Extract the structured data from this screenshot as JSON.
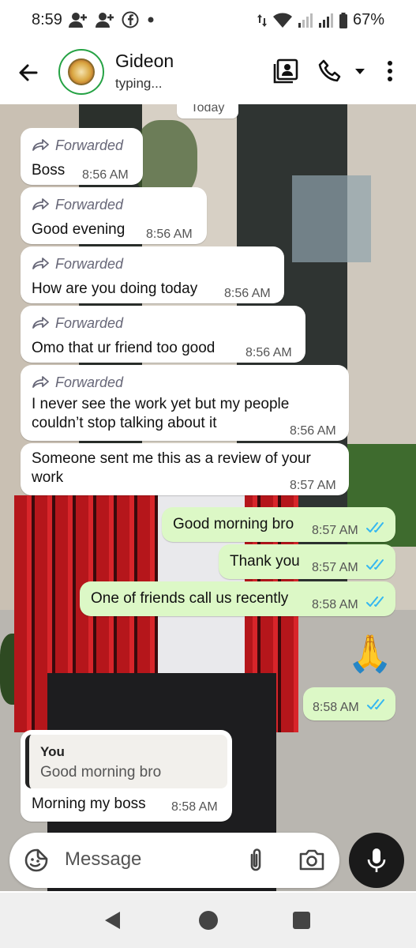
{
  "status_bar": {
    "time": "8:59",
    "battery": "67%",
    "icons": [
      "person-add-icon",
      "person-add-icon",
      "facebook-icon",
      "dot-icon",
      "data-arrows-icon",
      "wifi-icon",
      "signal-icon",
      "signal-icon",
      "battery-icon"
    ]
  },
  "header": {
    "contact_name": "Gideon",
    "status": "typing...",
    "icons": [
      "back-arrow-icon",
      "contact-card-icon",
      "phone-icon",
      "chevron-down-icon",
      "more-vert-icon"
    ]
  },
  "chat": {
    "date_chip": "Today",
    "forwarded_label": "Forwarded",
    "messages": [
      {
        "text": "Boss",
        "time": "8:56 AM"
      },
      {
        "text": "Good evening",
        "time": "8:56 AM"
      },
      {
        "text": "How are you doing today",
        "time": "8:56 AM"
      },
      {
        "text": "Omo that ur friend too good",
        "time": "8:56 AM"
      },
      {
        "line1": "I never see the work yet but my people",
        "line2": "couldn’t stop talking about it",
        "time": "8:56 AM"
      },
      {
        "line1": "Someone sent me this as a review of your",
        "line2": "work",
        "time": "8:57 AM"
      }
    ],
    "outgoing": [
      {
        "text": "Good morning bro",
        "time": "8:57 AM"
      },
      {
        "text": "Thank you",
        "time": "8:57 AM"
      },
      {
        "text": "One of friends call us recently",
        "time": "8:58 AM"
      },
      {
        "emoji": "🙏",
        "time": "8:58 AM"
      }
    ],
    "reply": {
      "quote_author": "You",
      "quote_text": "Good morning bro",
      "text": "Morning my boss",
      "time": "8:58 AM"
    }
  },
  "composer": {
    "placeholder": "Message",
    "icons": [
      "sticker-icon",
      "attach-icon",
      "camera-icon",
      "mic-icon"
    ]
  },
  "navbar": {
    "icons": [
      "back-triangle-icon",
      "home-circle-icon",
      "recents-square-icon"
    ]
  },
  "colors": {
    "outgoing_bubble": "#dcf8c6",
    "incoming_bubble": "#ffffff",
    "tick_blue": "#34b7f1",
    "avatar_ring": "#25a244"
  }
}
